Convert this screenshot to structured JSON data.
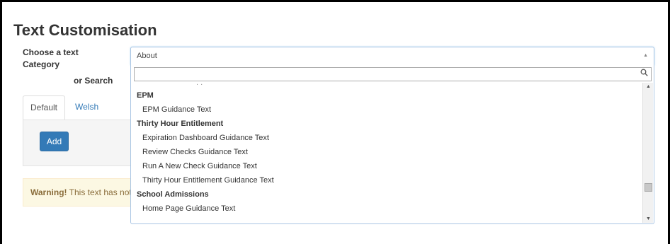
{
  "page": {
    "title": "Text Customisation",
    "category_label": "Choose a text Category",
    "or_search_label": "or Search"
  },
  "tabs": [
    {
      "label": "Default",
      "active": true
    },
    {
      "label": "Welsh",
      "active": false
    }
  ],
  "panel": {
    "add_label": "Add"
  },
  "warning": {
    "strong": "Warning!",
    "text": " This text has not"
  },
  "select": {
    "selected_value": "About",
    "search_value": "",
    "groups": [
      {
        "label": "EPM",
        "options": [
          "EPM Guidance Text"
        ]
      },
      {
        "label": "Thirty Hour Entitlement",
        "options": [
          "Expiration Dashboard Guidance Text",
          "Review Checks Guidance Text",
          "Run A New Check Guidance Text",
          "Thirty Hour Entitlement Guidance Text"
        ]
      },
      {
        "label": "School Admissions",
        "options": [
          "Home Page Guidance Text"
        ]
      }
    ]
  },
  "colors": {
    "primary": "#337ab7",
    "warning_bg": "#fcf8e3",
    "warning_text": "#8a6d3b",
    "focus_border": "#a9c5e3"
  },
  "icons": {
    "dropdown_arrow": "caret-up-icon",
    "search": "search-icon",
    "scroll_up": "scroll-up-icon",
    "scroll_down": "scroll-down-icon"
  }
}
